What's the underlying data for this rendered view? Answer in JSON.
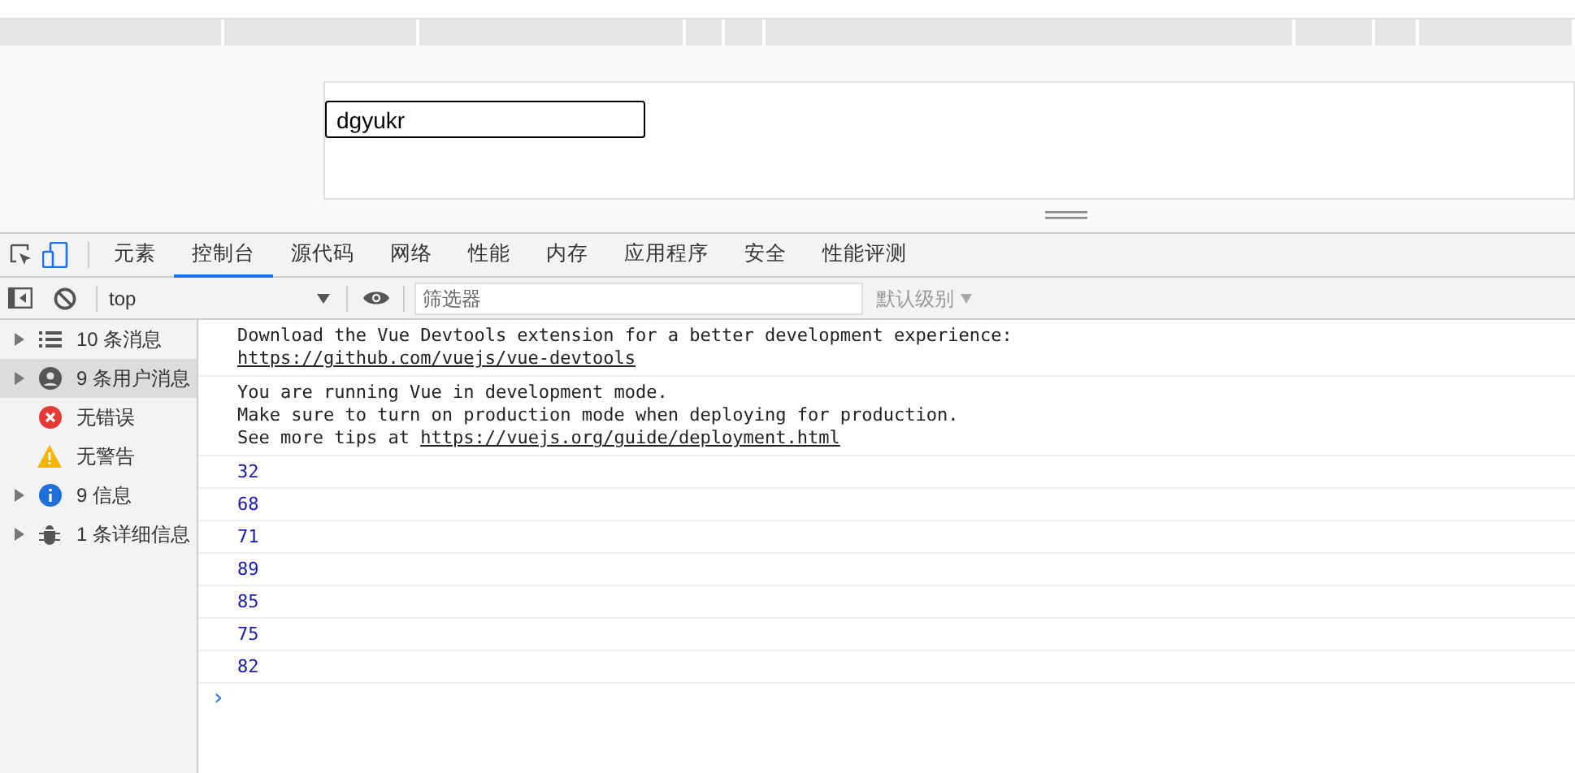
{
  "page": {
    "input_value": "dgyukr"
  },
  "tabs": [
    {
      "label": "元素",
      "selected": false
    },
    {
      "label": "控制台",
      "selected": true
    },
    {
      "label": "源代码",
      "selected": false
    },
    {
      "label": "网络",
      "selected": false
    },
    {
      "label": "性能",
      "selected": false
    },
    {
      "label": "内存",
      "selected": false
    },
    {
      "label": "应用程序",
      "selected": false
    },
    {
      "label": "安全",
      "selected": false
    },
    {
      "label": "性能评测",
      "selected": false
    }
  ],
  "toolbar": {
    "context": "top",
    "filter_placeholder": "筛选器",
    "levels": "默认级别"
  },
  "sidebar": [
    {
      "kind": "list",
      "label": "10 条消息",
      "expandable": true,
      "selected": false
    },
    {
      "kind": "user",
      "label": "9 条用户消息",
      "expandable": true,
      "selected": true
    },
    {
      "kind": "error",
      "label": "无错误",
      "expandable": false,
      "selected": false
    },
    {
      "kind": "warning",
      "label": "无警告",
      "expandable": false,
      "selected": false
    },
    {
      "kind": "info",
      "label": "9 信息",
      "expandable": true,
      "selected": false
    },
    {
      "kind": "verbose",
      "label": "1 条详细信息",
      "expandable": true,
      "selected": false
    }
  ],
  "messages": [
    {
      "kind": "text",
      "lines": [
        "Download the Vue Devtools extension for a better development experience:"
      ],
      "link": "https://github.com/vuejs/vue-devtools"
    },
    {
      "kind": "text",
      "lines": [
        "You are running Vue in development mode.",
        "Make sure to turn on production mode when deploying for production."
      ],
      "link_prefix": "See more tips at ",
      "link": "https://vuejs.org/guide/deployment.html"
    },
    {
      "kind": "number",
      "value": "32"
    },
    {
      "kind": "number",
      "value": "68"
    },
    {
      "kind": "number",
      "value": "71"
    },
    {
      "kind": "number",
      "value": "89"
    },
    {
      "kind": "number",
      "value": "85"
    },
    {
      "kind": "number",
      "value": "75"
    },
    {
      "kind": "number",
      "value": "82"
    }
  ],
  "prompt": "›"
}
